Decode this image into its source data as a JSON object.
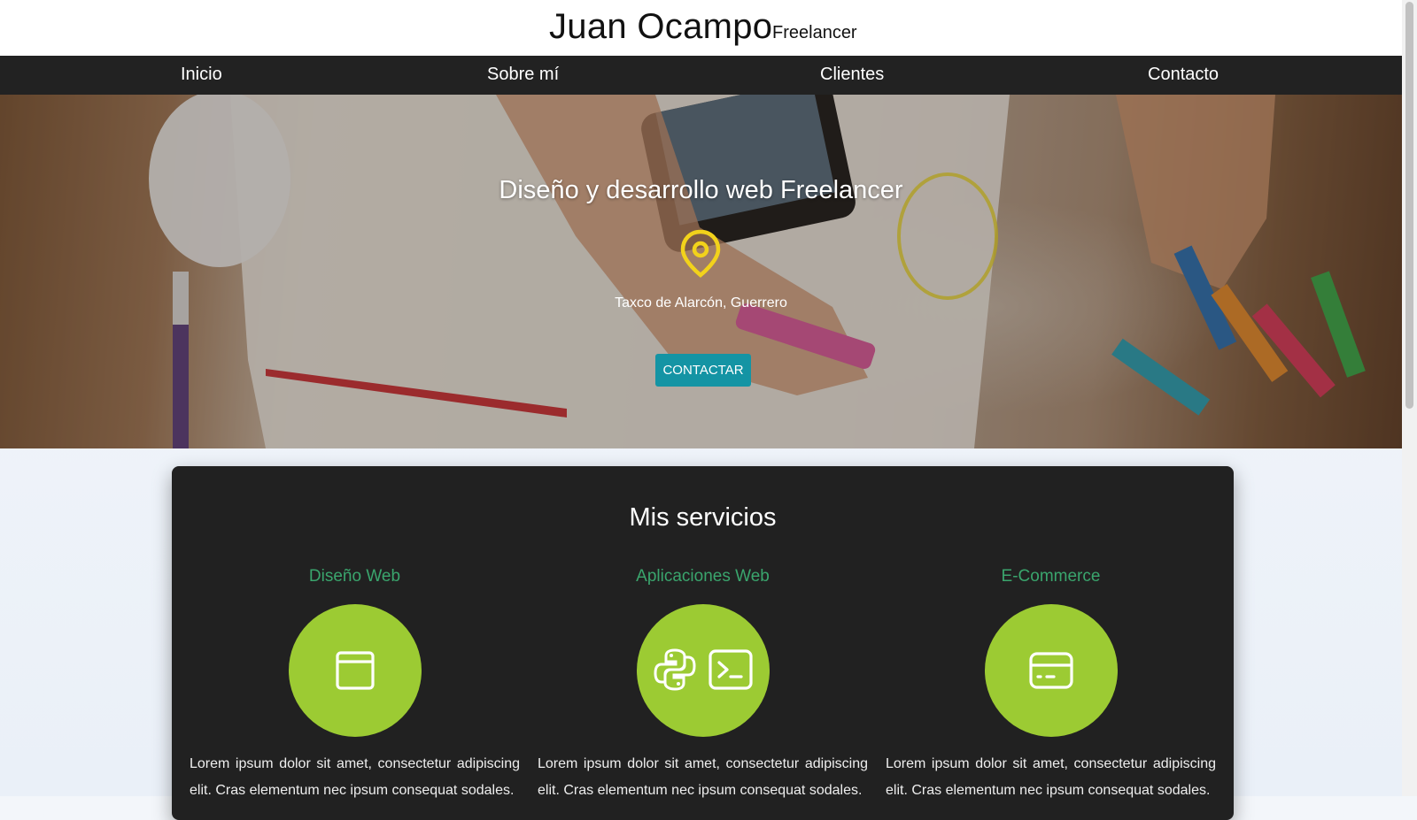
{
  "header": {
    "name": "Juan Ocampo",
    "role": "Freelancer"
  },
  "nav": {
    "items": [
      "Inicio",
      "Sobre mí",
      "Clientes",
      "Contacto"
    ]
  },
  "hero": {
    "title": "Diseño y desarrollo web Freelancer",
    "location": "Taxco de Alarcón, Guerrero",
    "button": "CONTACTAR",
    "pin_color": "#f2d21b"
  },
  "services": {
    "title": "Mis servicios",
    "items": [
      {
        "title": "Diseño Web",
        "icon": "browser-window-icon",
        "text": "Lorem ipsum dolor sit amet, consectetur adipiscing elit. Cras elementum nec ipsum consequat sodales."
      },
      {
        "title": "Aplicaciones Web",
        "icon": "python-terminal-icon",
        "text": "Lorem ipsum dolor sit amet, consectetur adipiscing elit. Cras elementum nec ipsum consequat sodales."
      },
      {
        "title": "E-Commerce",
        "icon": "credit-card-icon",
        "text": "Lorem ipsum dolor sit amet, consectetur adipiscing elit. Cras elementum nec ipsum consequat sodales."
      }
    ]
  },
  "colors": {
    "nav_bg": "#222222",
    "accent_button": "#1494a4",
    "service_title": "#3aa56d",
    "service_circle": "#9ccb33",
    "card_bg": "#212121"
  }
}
